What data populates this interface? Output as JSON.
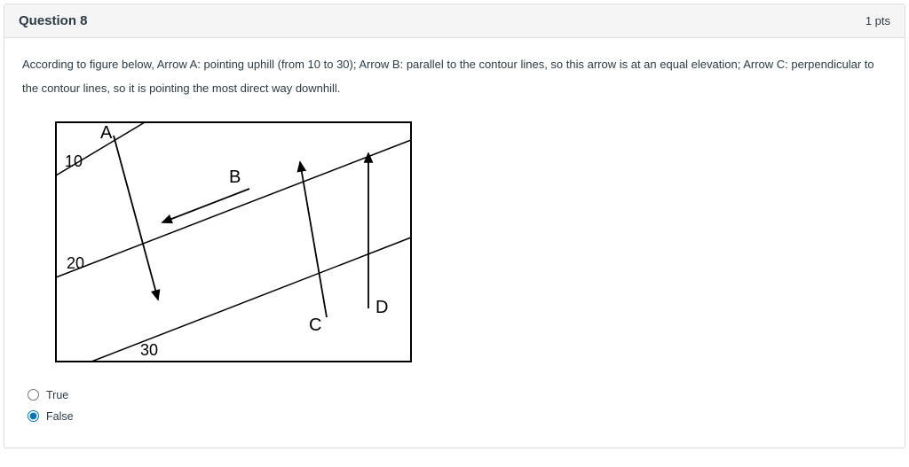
{
  "header": {
    "title": "Question 8",
    "points": "1 pts"
  },
  "question": {
    "text": "According to figure below, Arrow A: pointing uphill (from 10 to 30); Arrow B: parallel to the contour lines, so this arrow is at an equal elevation; Arrow C: perpendicular to the contour lines, so it is pointing the most direct way downhill."
  },
  "figure": {
    "labels": {
      "A": "A",
      "B": "B",
      "C": "C",
      "D": "D",
      "c10": "10",
      "c20": "20",
      "c30": "30"
    }
  },
  "answers": {
    "true_label": "True",
    "false_label": "False",
    "selected": "false"
  }
}
